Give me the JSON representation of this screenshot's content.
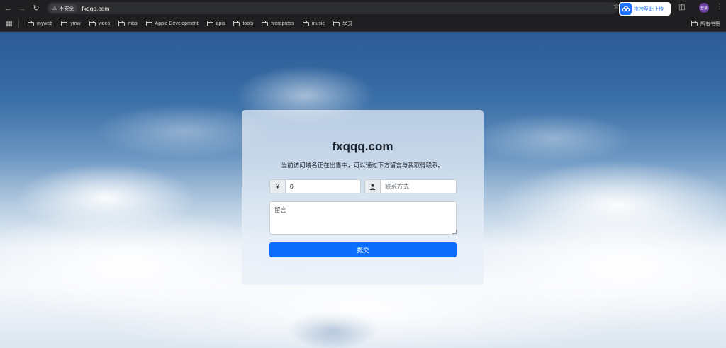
{
  "browser": {
    "security_label": "不安全",
    "url": "fxqqq.com",
    "extension_label": "拖拽至此上传",
    "profile_label": "登录"
  },
  "bookmarks": {
    "items": [
      {
        "label": "myweb"
      },
      {
        "label": "ymw"
      },
      {
        "label": "video"
      },
      {
        "label": "mbs"
      },
      {
        "label": "Apple Development"
      },
      {
        "label": "apis"
      },
      {
        "label": "tools"
      },
      {
        "label": "wordpress"
      },
      {
        "label": "music"
      },
      {
        "label": "学习"
      }
    ],
    "all_bookmarks_label": "所有书签"
  },
  "page": {
    "title": "fxqqq.com",
    "subtitle": "当前访问域名正在出售中，可以通过下方留言与我取得联系。",
    "price": {
      "symbol": "¥",
      "value": "0"
    },
    "contact": {
      "placeholder": "联系方式"
    },
    "message": {
      "placeholder": "留言"
    },
    "submit_label": "提交"
  },
  "colors": {
    "accent": "#0d6efd",
    "extension_blue": "#1a73ff",
    "browser_chrome": "#1f1f21"
  }
}
